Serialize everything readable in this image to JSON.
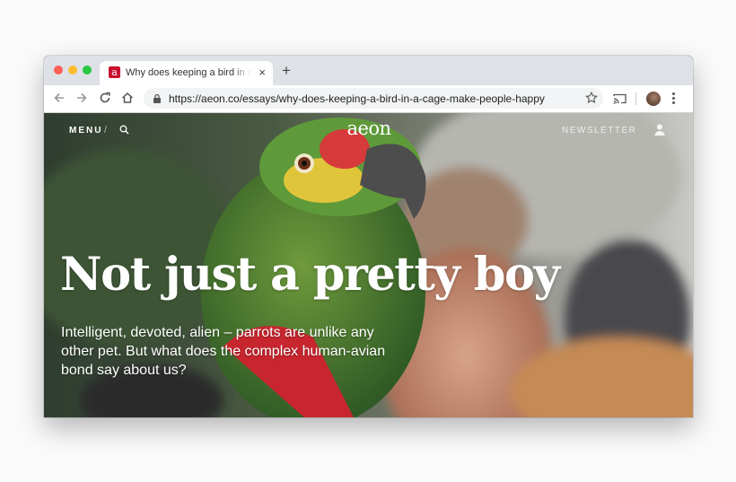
{
  "browser": {
    "tab": {
      "title": "Why does keeping a bird in a cage make people happy",
      "favicon_letter": "a",
      "close": "×"
    },
    "new_tab": "+",
    "url": "https://aeon.co/essays/why-does-keeping-a-bird-in-a-cage-make-people-happy"
  },
  "site": {
    "nav": {
      "menu_label": "MENU",
      "separator": "/",
      "logo": "aeon",
      "newsletter_label": "NEWSLETTER"
    },
    "article": {
      "headline": "Not just a pretty boy",
      "standfirst": "Intelligent, devoted, alien – parrots are unlike any other pet. But what does the complex human-avian bond say about us?"
    }
  },
  "icons": [
    "back-icon",
    "forward-icon",
    "reload-icon",
    "home-icon",
    "lock-icon",
    "star-icon",
    "cast-icon",
    "profile-icon",
    "kebab-menu-icon",
    "search-icon",
    "user-icon"
  ],
  "colors": {
    "brand_red": "#c8102e",
    "tabstrip": "#dee1e6",
    "omnibox": "#f1f3f4"
  }
}
